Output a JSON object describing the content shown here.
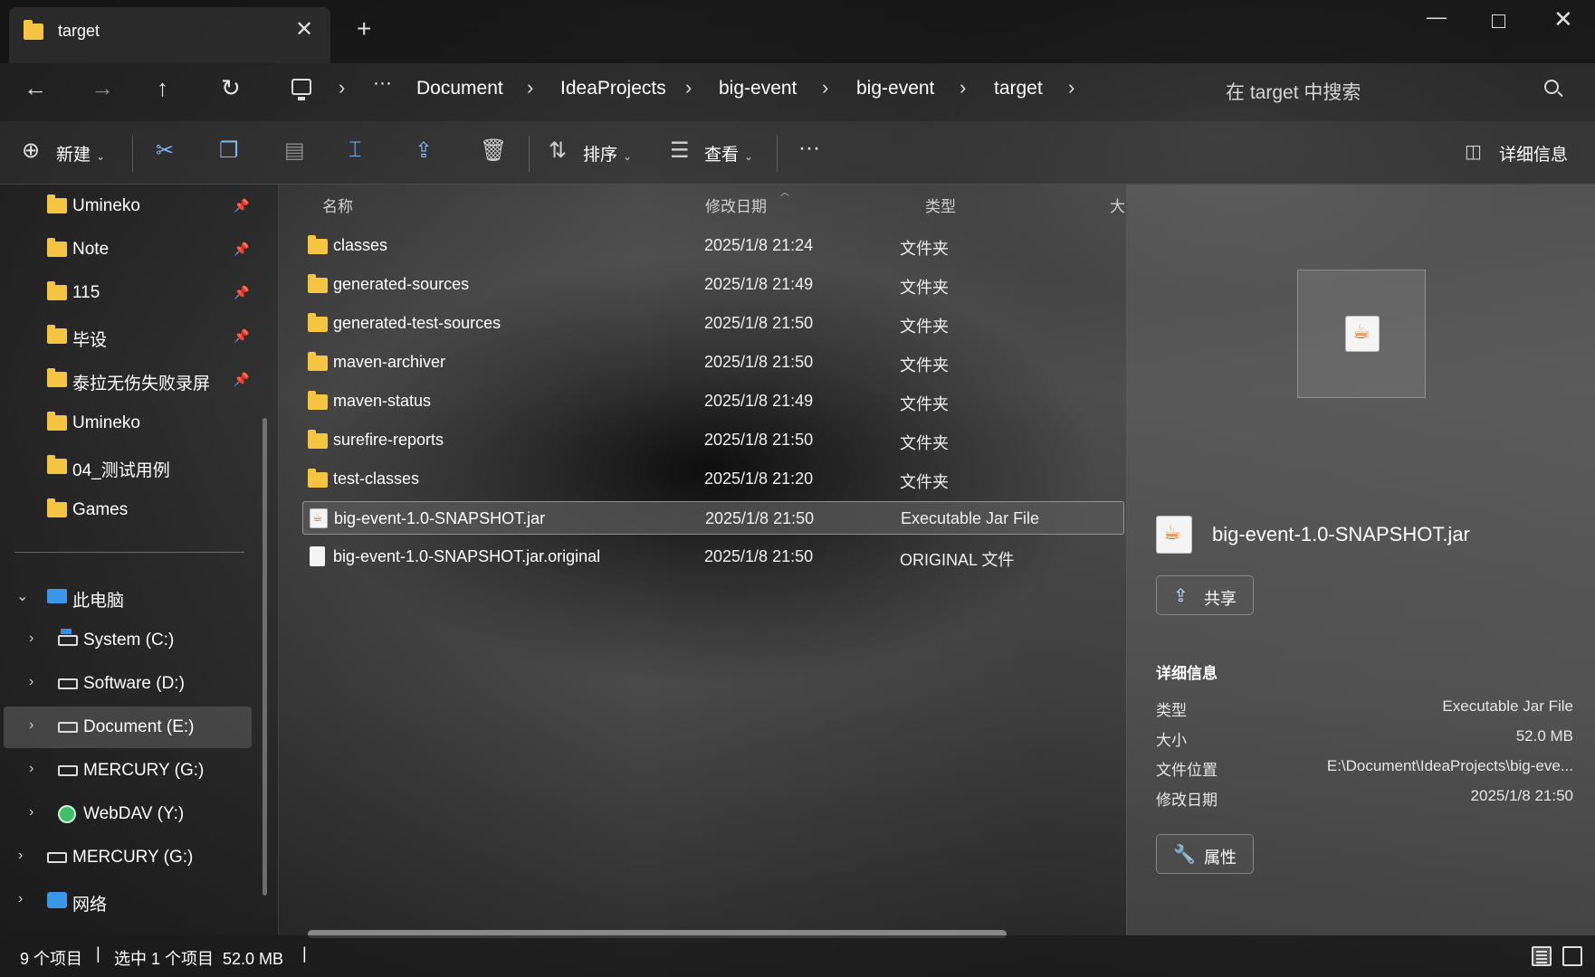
{
  "window": {
    "tab_title": "target",
    "tab_close": "✕",
    "tab_add": "+",
    "minimize": "—",
    "close": "✕"
  },
  "nav": {
    "back": "←",
    "forward": "→",
    "up": "↑",
    "refresh": "↻",
    "overflow": "···",
    "breadcrumbs": [
      "Document",
      "IdeaProjects",
      "big-event",
      "big-event",
      "target"
    ],
    "separator": "›",
    "search_placeholder": "在 target 中搜索"
  },
  "toolbar": {
    "new_label": "新建",
    "sort_label": "排序",
    "view_label": "查看",
    "more": "···",
    "details_label": "详细信息"
  },
  "sidebar": {
    "pinned": [
      {
        "label": "Umineko"
      },
      {
        "label": "Note"
      },
      {
        "label": "115"
      },
      {
        "label": "毕设"
      },
      {
        "label": "泰拉无伤失败录屏"
      }
    ],
    "recent": [
      {
        "label": "Umineko"
      },
      {
        "label": "04_测试用例"
      },
      {
        "label": "Games"
      }
    ],
    "this_pc": "此电脑",
    "drives": [
      {
        "label": "System (C:)",
        "icon": "system-drive-icon"
      },
      {
        "label": "Software (D:)",
        "icon": "drive-icon"
      },
      {
        "label": "Document (E:)",
        "icon": "drive-icon",
        "selected": true
      },
      {
        "label": "MERCURY (G:)",
        "icon": "drive-icon"
      },
      {
        "label": "WebDAV (Y:)",
        "icon": "globe-icon"
      }
    ],
    "removable": "MERCURY (G:)",
    "network": "网络",
    "pin_glyph": "📌",
    "expand_glyph": "›",
    "collapse_glyph": "⌄"
  },
  "filelist": {
    "headers": {
      "name": "名称",
      "date": "修改日期",
      "type": "类型",
      "size": "大"
    },
    "rows": [
      {
        "name": "classes",
        "date": "2025/1/8 21:24",
        "type": "文件夹",
        "kind": "folder"
      },
      {
        "name": "generated-sources",
        "date": "2025/1/8 21:49",
        "type": "文件夹",
        "kind": "folder"
      },
      {
        "name": "generated-test-sources",
        "date": "2025/1/8 21:50",
        "type": "文件夹",
        "kind": "folder"
      },
      {
        "name": "maven-archiver",
        "date": "2025/1/8 21:50",
        "type": "文件夹",
        "kind": "folder"
      },
      {
        "name": "maven-status",
        "date": "2025/1/8 21:49",
        "type": "文件夹",
        "kind": "folder"
      },
      {
        "name": "surefire-reports",
        "date": "2025/1/8 21:50",
        "type": "文件夹",
        "kind": "folder"
      },
      {
        "name": "test-classes",
        "date": "2025/1/8 21:20",
        "type": "文件夹",
        "kind": "folder"
      },
      {
        "name": "big-event-1.0-SNAPSHOT.jar",
        "date": "2025/1/8 21:50",
        "type": "Executable Jar File",
        "kind": "jar",
        "selected": true
      },
      {
        "name": "big-event-1.0-SNAPSHOT.jar.original",
        "date": "2025/1/8 21:50",
        "type": "ORIGINAL 文件",
        "kind": "file"
      }
    ]
  },
  "details": {
    "file_name": "big-event-1.0-SNAPSHOT.jar",
    "share_label": "共享",
    "section_title": "详细信息",
    "properties": [
      {
        "key": "类型",
        "value": "Executable Jar File"
      },
      {
        "key": "大小",
        "value": "52.0 MB"
      },
      {
        "key": "文件位置",
        "value": "E:\\Document\\IdeaProjects\\big-eve..."
      },
      {
        "key": "修改日期",
        "value": "2025/1/8 21:50"
      }
    ],
    "properties_label": "属性"
  },
  "status": {
    "item_count": "9 个项目",
    "selection": "选中 1 个项目  52.0 MB",
    "sep": "|"
  },
  "colors": {
    "folder": "#f5c542",
    "accent": "#7fb3ee"
  }
}
